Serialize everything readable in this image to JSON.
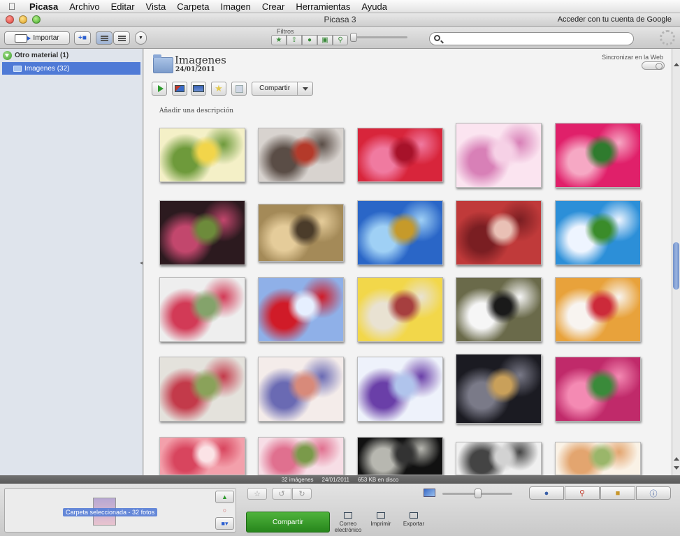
{
  "menubar": {
    "items": [
      "Picasa",
      "Archivo",
      "Editar",
      "Vista",
      "Carpeta",
      "Imagen",
      "Crear",
      "Herramientas",
      "Ayuda"
    ]
  },
  "titlebar": {
    "title": "Picasa 3",
    "account_link": "Acceder con tu cuenta de Google"
  },
  "toolbar": {
    "import_label": "Importar",
    "filters_label": "Filtros",
    "filter_icons": [
      "star-filter-icon",
      "upload-filter-icon",
      "person-filter-icon",
      "movie-filter-icon",
      "location-filter-icon"
    ],
    "search_placeholder": ""
  },
  "sidebar": {
    "group": "Otro material (1)",
    "folders": [
      {
        "label": "Imagenes (32)",
        "selected": true
      }
    ]
  },
  "album": {
    "title": "Imagenes",
    "date": "24/01/2011",
    "sync_label": "Sincronizar en la Web",
    "share_label": "Compartir",
    "description_placeholder": "Añadir una descripción"
  },
  "thumbnails": [
    {
      "subject": "heart-of-flowers",
      "colors": [
        "#f4f0c7",
        "#6e9a3b",
        "#f2d54a"
      ]
    },
    {
      "subject": "red-cups-on-table",
      "colors": [
        "#d8d3cf",
        "#5a4d46",
        "#b43a2a"
      ]
    },
    {
      "subject": "red-pink-roses",
      "colors": [
        "#d8253b",
        "#f07aa0",
        "#a7122a"
      ]
    },
    {
      "subject": "pink-orchids",
      "colors": [
        "#fbe4f0",
        "#d880b7",
        "#f6d1e6"
      ]
    },
    {
      "subject": "pink-rose-magenta",
      "colors": [
        "#e0206a",
        "#f6a8c4",
        "#2f7b2e"
      ]
    },
    {
      "subject": "flower-arrangement-dark",
      "colors": [
        "#2c1a1f",
        "#c2476d",
        "#6d8b3b"
      ]
    },
    {
      "subject": "sleeping-tigers",
      "colors": [
        "#a48a58",
        "#e5cc9a",
        "#4b3c2a"
      ]
    },
    {
      "subject": "lake-landscape",
      "colors": [
        "#2a66c7",
        "#9fd0f5",
        "#c69a2a"
      ]
    },
    {
      "subject": "red-room",
      "colors": [
        "#c03a3a",
        "#7a1e22",
        "#e9c0b5"
      ]
    },
    {
      "subject": "white-lily",
      "colors": [
        "#2c8fd8",
        "#eef5ff",
        "#3a8c2a"
      ]
    },
    {
      "subject": "vase-of-flowers",
      "colors": [
        "#eeeeee",
        "#d23a56",
        "#84a36b"
      ]
    },
    {
      "subject": "red-flowers-blue",
      "colors": [
        "#8fb0e8",
        "#d01b28",
        "#e6efff"
      ]
    },
    {
      "subject": "daisies-bouquet",
      "colors": [
        "#f2d74a",
        "#e9e2d2",
        "#a63f3f"
      ]
    },
    {
      "subject": "zebra",
      "colors": [
        "#6a6a4a",
        "#f6f6f6",
        "#1a1a1a"
      ]
    },
    {
      "subject": "daisies-orange-bg",
      "colors": [
        "#e8a23b",
        "#f8f4f0",
        "#cc2a3a"
      ]
    },
    {
      "subject": "flower-basket",
      "colors": [
        "#e4e2dc",
        "#c33a4a",
        "#8aa25a"
      ]
    },
    {
      "subject": "blue-flowers-pot",
      "colors": [
        "#f4ecea",
        "#6a6ab3",
        "#d88a7a"
      ]
    },
    {
      "subject": "purple-flowers-vase",
      "colors": [
        "#eef2fb",
        "#6a3fa8",
        "#b0c4ec"
      ]
    },
    {
      "subject": "man-in-city",
      "colors": [
        "#1b1b22",
        "#7a7a88",
        "#c9a05a"
      ]
    },
    {
      "subject": "pink-roses-magenta",
      "colors": [
        "#c02a6a",
        "#f48ab3",
        "#3a8a3a"
      ]
    },
    {
      "subject": "pink-carnations",
      "colors": [
        "#f3a0ab",
        "#d8455e",
        "#fbe3e6"
      ]
    },
    {
      "subject": "pink-roses-bouquet",
      "colors": [
        "#f7dee6",
        "#e0708f",
        "#7a9a4a"
      ]
    },
    {
      "subject": "white-lizard-black",
      "colors": [
        "#111111",
        "#b7b7b0",
        "#333333"
      ]
    },
    {
      "subject": "white-sports-car",
      "colors": [
        "#f0f0f0",
        "#444444",
        "#d2d2d2"
      ]
    },
    {
      "subject": "floral-pattern",
      "colors": [
        "#faf2e6",
        "#e3a56f",
        "#9ab66a"
      ]
    }
  ],
  "status": {
    "count": "32 imágenes",
    "date": "24/01/2011",
    "size": "653 KB en disco"
  },
  "bottom": {
    "tray_label": "Carpeta seleccionada - 32 fotos",
    "share_label": "Compartir",
    "actions": [
      {
        "label": "Correo\nelectrónico",
        "icon": "mail-icon"
      },
      {
        "label": "Imprimir",
        "icon": "print-icon"
      },
      {
        "label": "Exportar",
        "icon": "export-icon"
      }
    ],
    "tag_buttons": [
      "person-icon",
      "pin-icon",
      "tag-icon",
      "info-icon"
    ]
  },
  "colors": {
    "selection": "#4f7ad6",
    "share_green": "#3a9e2c",
    "sidebar_bg": "#dfe4ec"
  }
}
